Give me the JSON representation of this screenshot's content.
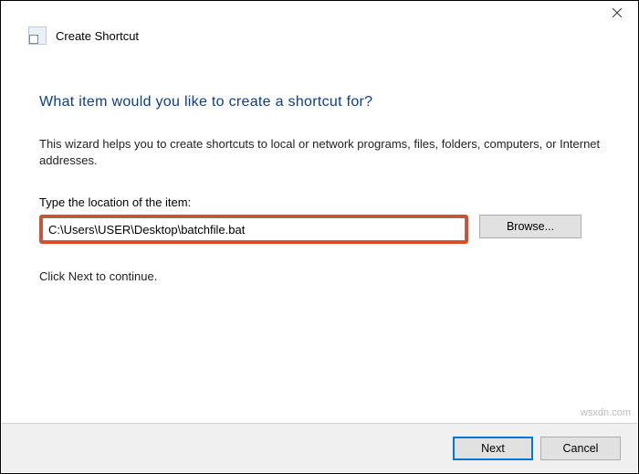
{
  "window": {
    "title": "Create Shortcut"
  },
  "heading": "What item would you like to create a shortcut for?",
  "description": "This wizard helps you to create shortcuts to local or network programs, files, folders, computers, or Internet addresses.",
  "location": {
    "label": "Type the location of the item:",
    "value": "C:\\Users\\USER\\Desktop\\batchfile.bat",
    "browse_label": "Browse..."
  },
  "continue_text": "Click Next to continue.",
  "footer": {
    "next_label": "Next",
    "cancel_label": "Cancel"
  },
  "watermark": "wsxdn.com"
}
